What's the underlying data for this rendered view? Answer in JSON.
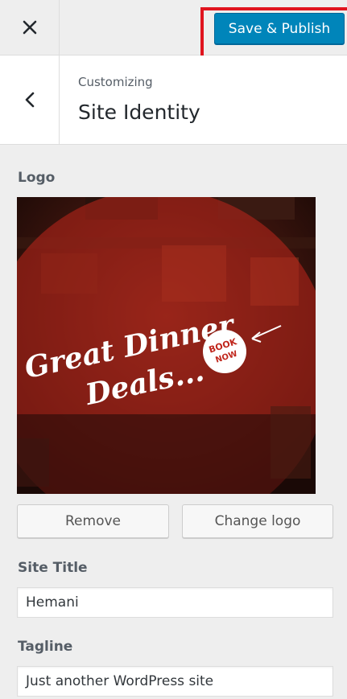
{
  "header": {
    "close_icon": "close-icon",
    "publish_label": "Save & Publish"
  },
  "section": {
    "back_icon": "chevron-left-icon",
    "breadcrumb": "Customizing",
    "title": "Site Identity"
  },
  "logo": {
    "label": "Logo",
    "image_text_line1": "Great Dinner",
    "image_text_line2": "Deals...",
    "badge_line1": "BOOK",
    "badge_line2": "NOW",
    "remove_label": "Remove",
    "change_label": "Change logo"
  },
  "site_title": {
    "label": "Site Title",
    "value": "Hemani"
  },
  "tagline": {
    "label": "Tagline",
    "value": "Just another WordPress site"
  },
  "colors": {
    "primary": "#0085ba",
    "highlight": "#e0141e"
  }
}
